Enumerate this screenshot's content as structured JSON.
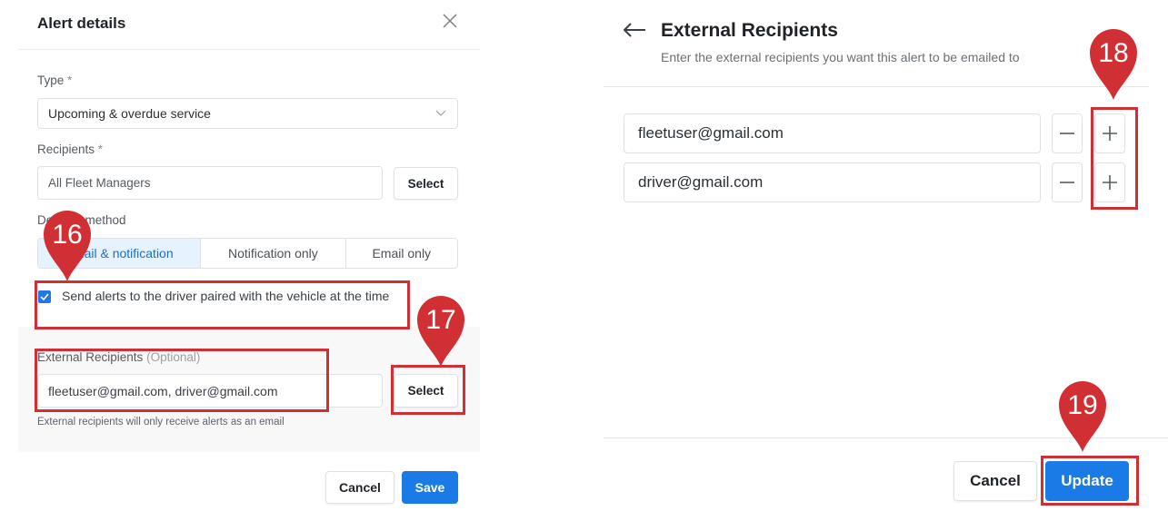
{
  "left_panel": {
    "title": "Alert details",
    "type": {
      "label": "Type",
      "required_mark": "*",
      "value": "Upcoming & overdue service"
    },
    "recipients": {
      "label": "Recipients",
      "required_mark": "*",
      "value": "All Fleet Managers",
      "select_label": "Select"
    },
    "delivery_method": {
      "label": "Delivery method",
      "options": [
        "Email & notification",
        "Notification only",
        "Email only"
      ],
      "selected": "Email & notification"
    },
    "driver_checkbox": {
      "checked": true,
      "label": "Send alerts to the driver paired with the vehicle at the time"
    },
    "external_recipients": {
      "label": "External Recipients",
      "optional": "(Optional)",
      "value": "fleetuser@gmail.com, driver@gmail.com",
      "select_label": "Select",
      "hint": "External recipients will only receive alerts as an email"
    },
    "footer": {
      "cancel_label": "Cancel",
      "save_label": "Save"
    }
  },
  "right_panel": {
    "title": "External Recipients",
    "subtitle": "Enter the external recipients you want this alert to be emailed to",
    "emails": [
      "fleetuser@gmail.com",
      "driver@gmail.com"
    ],
    "footer": {
      "cancel_label": "Cancel",
      "update_label": "Update"
    }
  },
  "callouts": [
    "16",
    "17",
    "18",
    "19"
  ],
  "colors": {
    "accent": "#1a7be6",
    "callout": "#d03033",
    "selected_segment_bg": "#e6f2fd"
  },
  "icons": [
    "close-icon",
    "chevron-down-icon",
    "checkmark-icon",
    "back-arrow-icon",
    "minus-icon",
    "plus-icon",
    "map-pin-icon"
  ]
}
